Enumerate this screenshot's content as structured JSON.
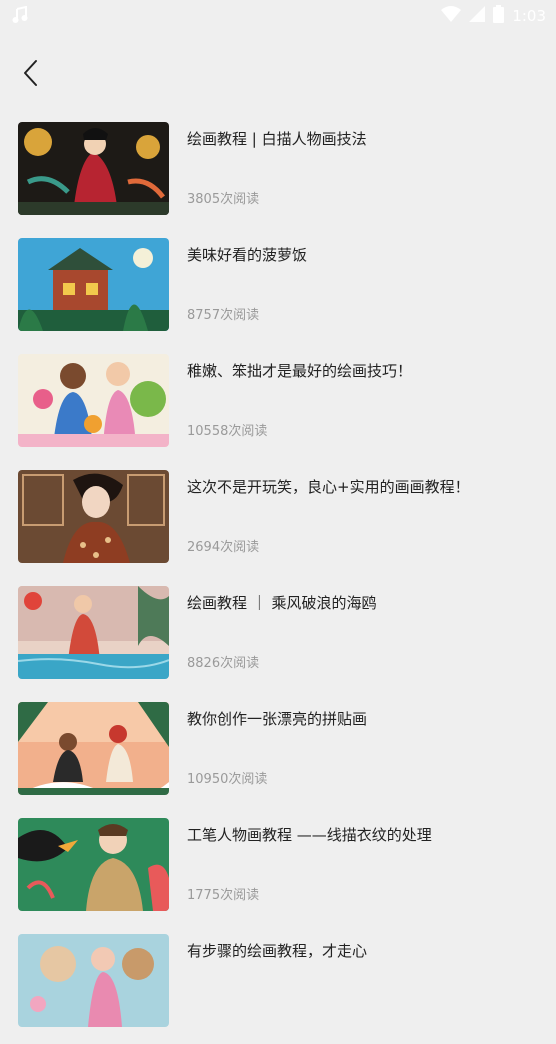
{
  "status_bar": {
    "time": "1:03",
    "icons": [
      "music-note-icon",
      "wifi-icon",
      "signal-icon",
      "battery-icon"
    ]
  },
  "header": {
    "back_icon": "chevron-left-icon"
  },
  "articles": [
    {
      "title": "绘画教程 | 白描人物画技法",
      "reads": "3805次阅读"
    },
    {
      "title": "美味好看的菠萝饭",
      "reads": "8757次阅读"
    },
    {
      "title": "稚嫩、笨拙才是最好的绘画技巧！",
      "reads": "10558次阅读"
    },
    {
      "title": "这次不是开玩笑，良心+实用的画画教程！",
      "reads": "2694次阅读"
    },
    {
      "title": "绘画教程 ｜ 乘风破浪的海鸥",
      "reads": "8826次阅读"
    },
    {
      "title": "教你创作一张漂亮的拼贴画",
      "reads": "10950次阅读"
    },
    {
      "title": "工笔人物画教程 ——线描衣纹的处理",
      "reads": "1775次阅读"
    },
    {
      "title": "有步骤的绘画教程，才走心",
      "reads": ""
    }
  ],
  "colors": {
    "background": "#efefef",
    "title_text": "#222222",
    "meta_text": "#9a9a9a"
  }
}
